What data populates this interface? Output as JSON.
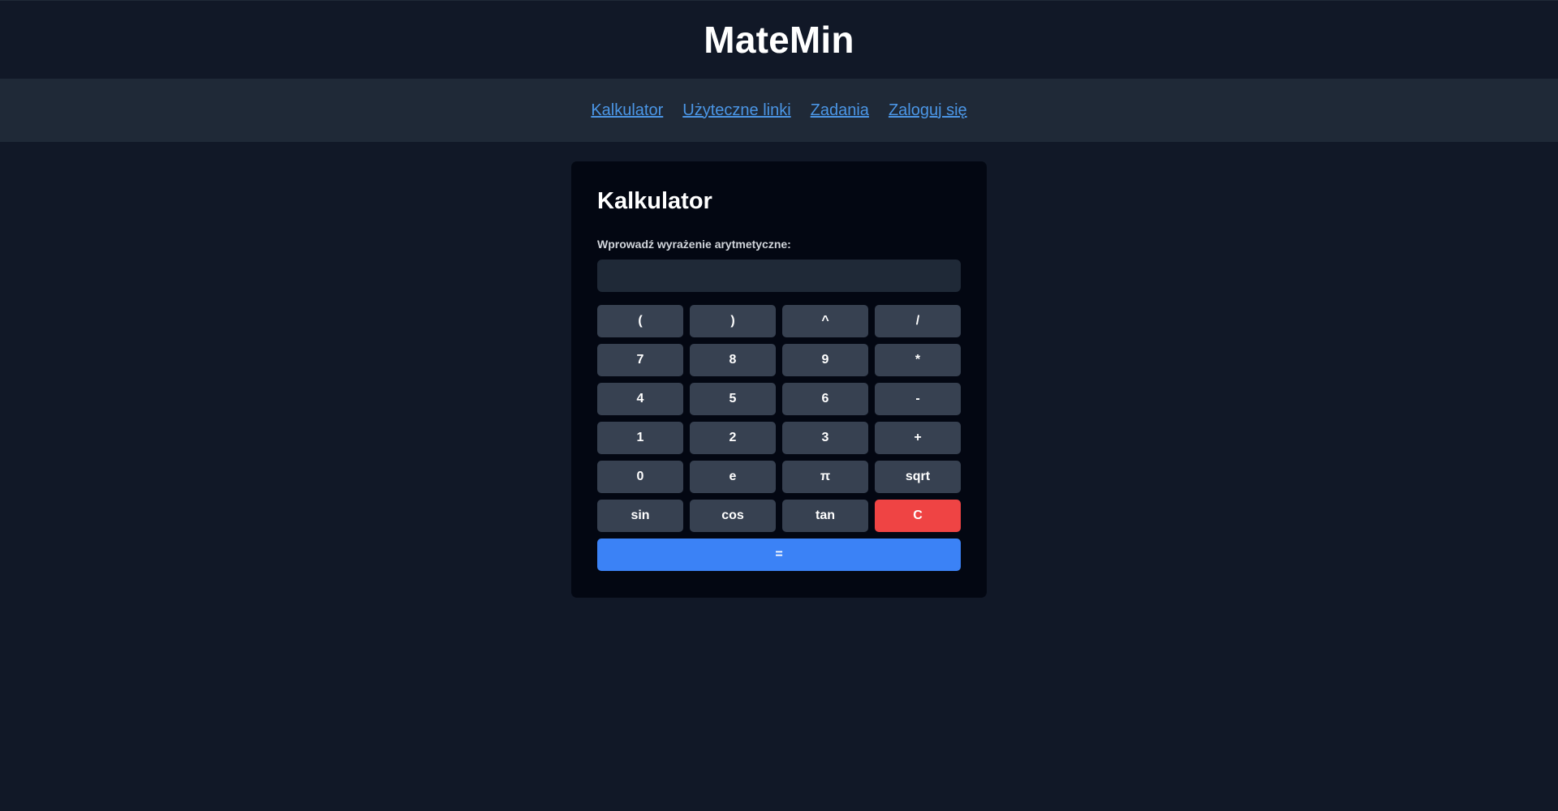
{
  "header": {
    "title": "MateMin"
  },
  "nav": {
    "items": [
      {
        "label": "Kalkulator"
      },
      {
        "label": "Użyteczne linki"
      },
      {
        "label": "Zadania"
      },
      {
        "label": "Zaloguj się"
      }
    ]
  },
  "calculator": {
    "title": "Kalkulator",
    "input_label": "Wprowadź wyrażenie arytmetyczne:",
    "input_value": "",
    "keys": [
      "(",
      ")",
      "^",
      "/",
      "7",
      "8",
      "9",
      "*",
      "4",
      "5",
      "6",
      "-",
      "1",
      "2",
      "3",
      "+",
      "0",
      "e",
      "π",
      "sqrt",
      "sin",
      "cos",
      "tan",
      "C",
      "="
    ]
  },
  "colors": {
    "page_background": "#111827",
    "nav_background": "#1f2937",
    "card_background": "#030712",
    "link": "#4b96e6",
    "key": "#374151",
    "clear_key": "#ef4444",
    "equals_key": "#3b82f6"
  }
}
